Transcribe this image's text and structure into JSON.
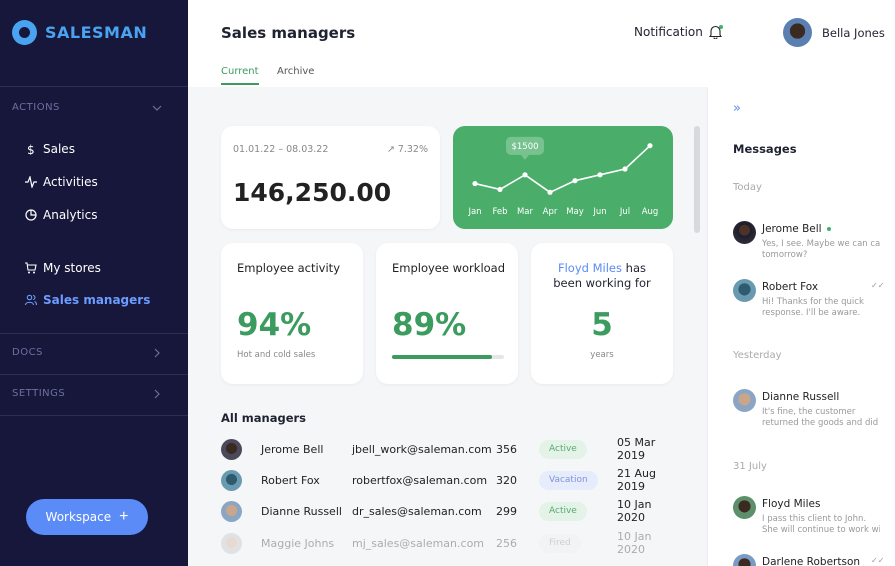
{
  "brand": {
    "name": "SALESMAN",
    "accent": "#4aa3f0"
  },
  "sidebar": {
    "actions_label": "ACTIONS",
    "items": [
      {
        "label": "Sales",
        "icon": "dollar-icon"
      },
      {
        "label": "Activities",
        "icon": "activity-icon"
      },
      {
        "label": "Analytics",
        "icon": "pie-chart-icon"
      },
      {
        "label": "My stores",
        "icon": "cart-icon"
      },
      {
        "label": "Sales managers",
        "icon": "users-icon",
        "active": true
      }
    ],
    "docs_label": "DOCS",
    "settings_label": "SETTINGS",
    "workspace_label": "Workspace"
  },
  "header": {
    "title": "Sales managers",
    "tabs": [
      {
        "label": "Current",
        "active": true
      },
      {
        "label": "Archive",
        "active": false
      }
    ],
    "notification_label": "Notification",
    "user_name": "Bella Jones"
  },
  "summary": {
    "date_range": "01.01.22 – 08.03.22",
    "change": "7.32%",
    "total": "146,250.00"
  },
  "chart_data": {
    "type": "line",
    "categories": [
      "Jan",
      "Feb",
      "Mar",
      "Apr",
      "May",
      "Jun",
      "Jul",
      "Aug"
    ],
    "values": [
      1350,
      1250,
      1500,
      1200,
      1400,
      1500,
      1600,
      2000
    ],
    "tooltip": "$1500",
    "tooltip_index": 2
  },
  "stats": {
    "activity": {
      "title": "Employee activity",
      "value": "94%",
      "sub": "Hot and cold sales"
    },
    "workload": {
      "title": "Employee workload",
      "value": "89%",
      "progress": 0.89
    },
    "tenure": {
      "name": "Floyd Miles",
      "suffix1": " has",
      "suffix2": "been working for",
      "value": "5",
      "sub": "years"
    }
  },
  "managers": {
    "title": "All managers",
    "rows": [
      {
        "name": "Jerome Bell",
        "email": "jbell_work@saleman.com",
        "count": "356",
        "status": "Active",
        "date": "05 Mar 2019",
        "status_bg": "#e3f3e8",
        "status_fg": "#5aa872"
      },
      {
        "name": "Robert Fox",
        "email": "robertfox@saleman.com",
        "count": "320",
        "status": "Vacation",
        "date": "21 Aug 2019",
        "status_bg": "#e6ecfb",
        "status_fg": "#7d95d8"
      },
      {
        "name": "Dianne Russell",
        "email": "dr_sales@saleman.com",
        "count": "299",
        "status": "Active",
        "date": "10 Jan 2020",
        "status_bg": "#e3f3e8",
        "status_fg": "#5aa872"
      },
      {
        "name": "Maggie Johns",
        "email": "mj_sales@saleman.com",
        "count": "256",
        "status": "Fired",
        "date": "10 Jan 2020",
        "status_bg": "#eeeeee",
        "status_fg": "#888888"
      }
    ]
  },
  "messages": {
    "title": "Messages",
    "today": "Today",
    "yesterday": "Yesterday",
    "july": "31 July",
    "items": [
      {
        "name": "Jerome Bell",
        "text1": "Yes, I see. Maybe we can call",
        "text2": "tomorrow?"
      },
      {
        "name": "Robert Fox",
        "text1": "Hi! Thanks for the quick",
        "text2": "response. I'll be aware."
      },
      {
        "name": "Dianne Russell",
        "text1": "It's fine, the customer",
        "text2": "returned the goods and did it"
      },
      {
        "name": "Floyd Miles",
        "text1": "I pass this client to John.",
        "text2": "She will continue to work with"
      },
      {
        "name": "Darlene Robertson",
        "text1": "",
        "text2": ""
      }
    ]
  }
}
